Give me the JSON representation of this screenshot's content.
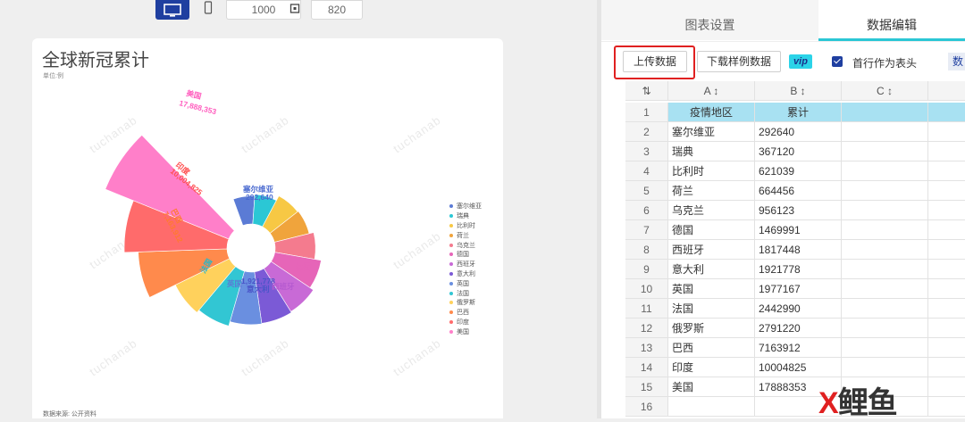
{
  "topbar": {
    "width_value": "1000",
    "height_value": "820"
  },
  "chart": {
    "title": "全球新冠累计",
    "unit": "单位:例",
    "source": "数据来源: 公开资料",
    "watermark": "tuchanab",
    "labels": {
      "us": [
        "美国",
        "17,888,353"
      ],
      "india": [
        "印度",
        "10,004,825"
      ],
      "brazil": [
        "巴西",
        "7,163,912"
      ],
      "serbia": [
        "塞尔维亚",
        "292,640"
      ],
      "italy": [
        "1,921,778",
        "意大利"
      ],
      "uk": "英国",
      "spain": "西班牙",
      "germany": "德国",
      "france": "法国"
    }
  },
  "chart_data": {
    "type": "pie",
    "variant": "nightingale-rose",
    "title": "全球新冠累计",
    "unit": "单位:例",
    "categories": [
      "塞尔维亚",
      "瑞典",
      "比利时",
      "荷兰",
      "乌克兰",
      "德国",
      "西班牙",
      "意大利",
      "英国",
      "法国",
      "俄罗斯",
      "巴西",
      "印度",
      "美国"
    ],
    "values": [
      292640,
      367120,
      621039,
      664456,
      956123,
      1469991,
      1817448,
      1921778,
      1977167,
      2442990,
      2791220,
      7163912,
      10004825,
      17888353
    ],
    "colors": [
      "#5b7bd5",
      "#2bc7d5",
      "#f7c844",
      "#f0a43c",
      "#f47b8e",
      "#e665b8",
      "#c86ad6",
      "#7b5ad6",
      "#6a8fe0",
      "#32c6d3",
      "#ffd15c",
      "#ff8a4c",
      "#ff6b6b",
      "#ff7fc9"
    ],
    "legend_position": "right"
  },
  "panel": {
    "tabs": [
      "图表设置",
      "数据编辑"
    ],
    "upload_label": "上传数据",
    "download_label": "下载样例数据",
    "vip": "vip",
    "first_row_header": "首行作为表头",
    "num_chip": "数"
  },
  "grid": {
    "columns": [
      "A ↕",
      "B ↕",
      "C ↕"
    ],
    "rows": [
      [
        "1",
        "疫情地区",
        "累计"
      ],
      [
        "2",
        "塞尔维亚",
        "292640"
      ],
      [
        "3",
        "瑞典",
        "367120"
      ],
      [
        "4",
        "比利时",
        "621039"
      ],
      [
        "5",
        "荷兰",
        "664456"
      ],
      [
        "6",
        "乌克兰",
        "956123"
      ],
      [
        "7",
        "德国",
        "1469991"
      ],
      [
        "8",
        "西班牙",
        "1817448"
      ],
      [
        "9",
        "意大利",
        "1921778"
      ],
      [
        "10",
        "英国",
        "1977167"
      ],
      [
        "11",
        "法国",
        "2442990"
      ],
      [
        "12",
        "俄罗斯",
        "2791220"
      ],
      [
        "13",
        "巴西",
        "7163912"
      ],
      [
        "14",
        "印度",
        "10004825"
      ],
      [
        "15",
        "美国",
        "17888353"
      ],
      [
        "16",
        "",
        ""
      ]
    ]
  },
  "brand": {
    "left": "X",
    "right": "鲤鱼"
  }
}
